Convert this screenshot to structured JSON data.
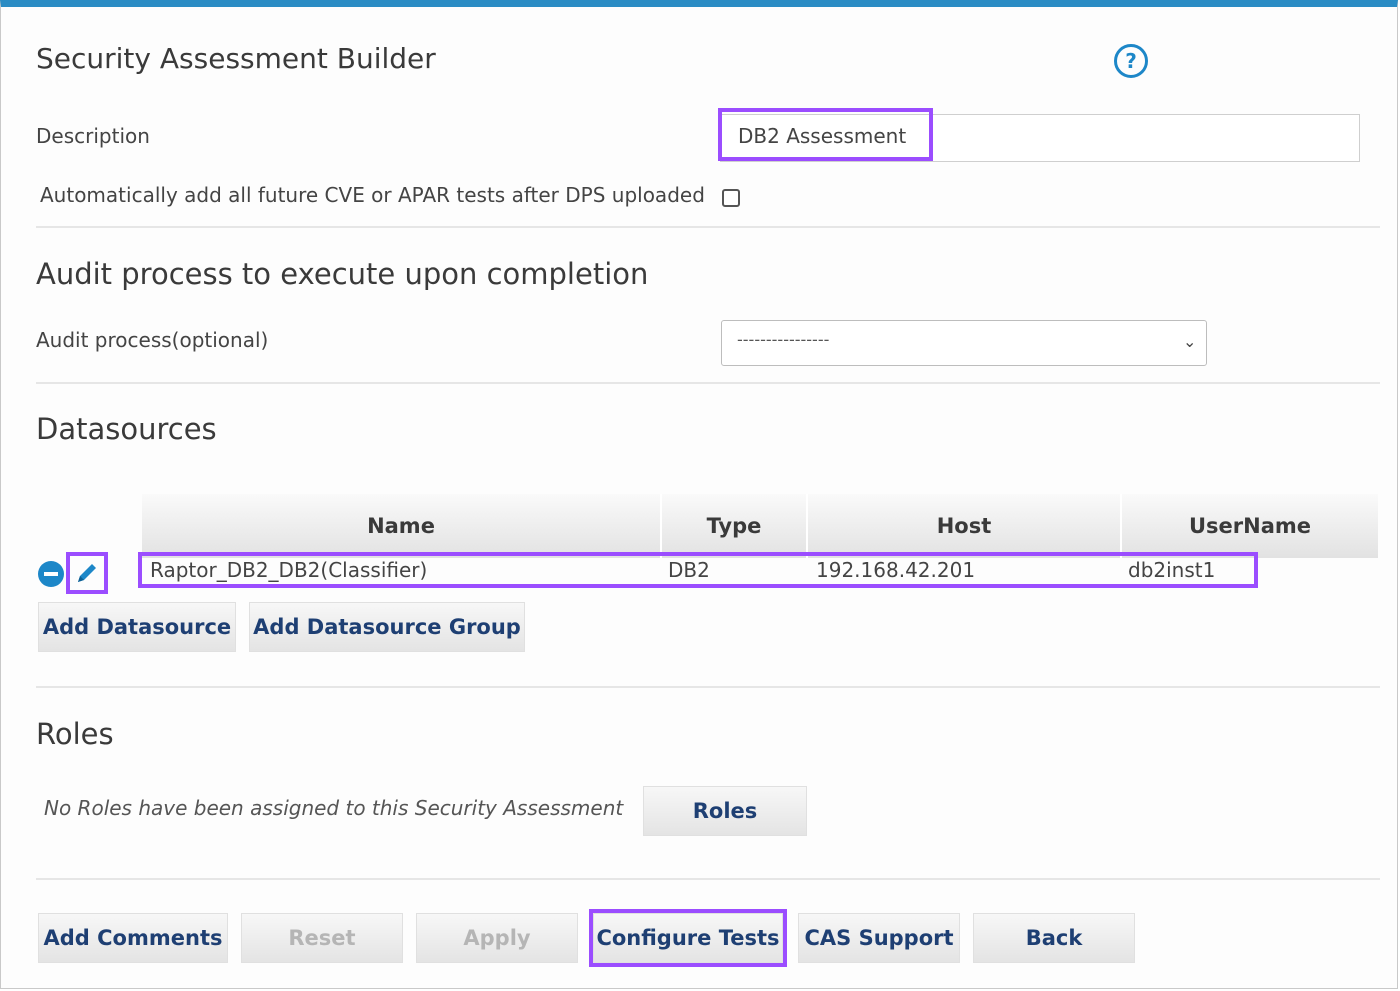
{
  "header": {
    "title": "Security Assessment Builder",
    "help_icon": "question-circle-icon",
    "help_glyph": "?"
  },
  "description": {
    "label": "Description",
    "value": "DB2 Assessment"
  },
  "auto_add": {
    "label": "Automatically add all future CVE or APAR tests after DPS uploaded",
    "checked": false
  },
  "audit": {
    "heading": "Audit process to execute upon completion",
    "label": "Audit process(optional)",
    "selected": "----------------",
    "chevron": "⌄"
  },
  "datasources": {
    "heading": "Datasources",
    "columns": [
      "Name",
      "Type",
      "Host",
      "UserName"
    ],
    "rows": [
      {
        "name": "Raptor_DB2_DB2(Classifier)",
        "type": "DB2",
        "host": "192.168.42.201",
        "username": "db2inst1"
      }
    ],
    "remove_icon": "minus-circle-icon",
    "edit_icon": "pencil-icon",
    "add_datasource": "Add Datasource",
    "add_datasource_group": "Add Datasource Group"
  },
  "roles": {
    "heading": "Roles",
    "note": "No Roles have been assigned to this Security Assessment",
    "button": "Roles"
  },
  "footer": {
    "add_comments": "Add Comments",
    "reset": "Reset",
    "apply": "Apply",
    "configure_tests": "Configure Tests",
    "cas_support": "CAS Support",
    "back": "Back"
  },
  "colors": {
    "accent": "#2b8cc4",
    "highlight": "#9b4dff",
    "button_text": "#1e3f73"
  }
}
